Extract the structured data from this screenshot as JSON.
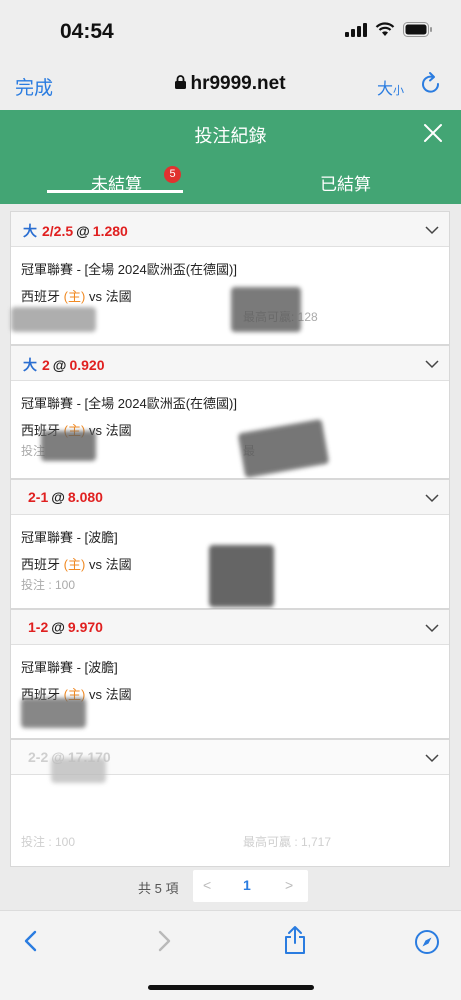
{
  "status": {
    "time": "04:54"
  },
  "browser": {
    "done_label": "完成",
    "url": "hr9999.net",
    "text_size_big": "大",
    "text_size_small": "小"
  },
  "modal": {
    "title": "投注紀錄",
    "tabs": [
      {
        "label": "未結算",
        "badge": "5",
        "active": true
      },
      {
        "label": "已結算",
        "active": false
      }
    ]
  },
  "bets": [
    {
      "side": "大",
      "line": "2/2.5",
      "at": "@",
      "odds": "1.280",
      "league": "冠軍聯賽 - [全場 2024歐洲盃(在德國)]",
      "home_team": "西班牙",
      "home_tag": "(主)",
      "vs": "vs",
      "away_team": "法國",
      "stake_label": "",
      "win_label": "最高可贏: 128"
    },
    {
      "side": "大",
      "line": "2",
      "at": "@",
      "odds": "0.920",
      "league": "冠軍聯賽 - [全場 2024歐洲盃(在德國)]",
      "home_team": "西班牙",
      "home_tag": "(主)",
      "vs": "vs",
      "away_team": "法國",
      "stake_label": "投注",
      "win_label": "最"
    },
    {
      "side": "",
      "line": "2-1",
      "at": "@",
      "odds": "8.080",
      "league": "冠軍聯賽 - [波膽]",
      "home_team": "西班牙",
      "home_tag": "(主)",
      "vs": "vs",
      "away_team": "法國",
      "stake_label": "投注 : 100",
      "win_label": ""
    },
    {
      "side": "",
      "line": "1-2",
      "at": "@",
      "odds": "9.970",
      "league": "冠軍聯賽 - [波膽]",
      "home_team": "西班牙",
      "home_tag": "(主)",
      "vs": "vs",
      "away_team": "法國",
      "stake_label": "",
      "win_label": ""
    },
    {
      "side": "",
      "line": "2-2",
      "at": "@",
      "odds": "17.170",
      "league": "",
      "home_team": "",
      "home_tag": "",
      "vs": "",
      "away_team": "",
      "stake_label": "投注 : 100",
      "win_label": "最高可贏 : 1,717"
    }
  ],
  "pager": {
    "total": "共 5 項",
    "prev": "<",
    "current": "1",
    "next": ">"
  },
  "colors": {
    "header_green": "#43a574",
    "accent_blue": "#2a7ce0",
    "odds_red": "#e02020",
    "home_orange": "#f08a24"
  }
}
